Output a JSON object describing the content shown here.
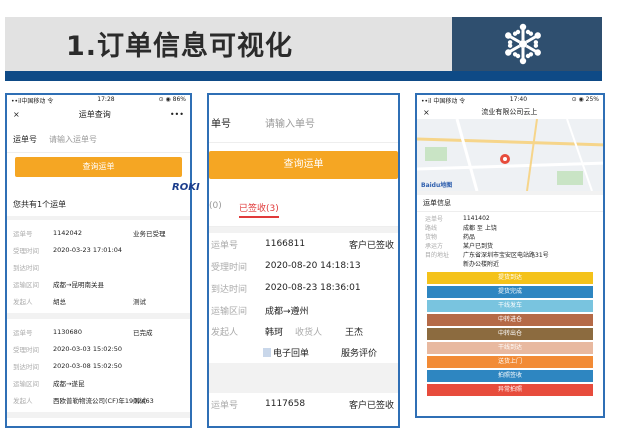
{
  "header": {
    "title": "1.订单信息可视化"
  },
  "p1": {
    "status_left": "••il中国移动 令",
    "status_time": "17:28",
    "status_right": "⊙ ◉ 86%",
    "close": "×",
    "nav_title": "运单查询",
    "more": "•••",
    "input_label": "运单号",
    "input_placeholder": "请输入运单号",
    "query_button": "查询运单",
    "count_text": "您共有1个运单",
    "watermark": "ROKI",
    "orders": [
      {
        "rows": [
          [
            "运单号",
            "1142042",
            "业务已受理"
          ],
          [
            "受理时间",
            "2020-03-23 17:01:04",
            ""
          ],
          [
            "到达时间",
            "",
            ""
          ],
          [
            "运输区间",
            "成都→昆明南关县",
            ""
          ],
          [
            "发起人",
            "胡总",
            "测试"
          ]
        ]
      },
      {
        "rows": [
          [
            "运单号",
            "1130680",
            "已完成"
          ],
          [
            "受理时间",
            "2020-03-03 15:02:50",
            ""
          ],
          [
            "到达时间",
            "2020-03-08 15:02:50",
            ""
          ],
          [
            "运输区间",
            "成都→遂昆",
            ""
          ],
          [
            "发起人",
            "西欧普勒物流公司(CF)年1902463",
            "测试"
          ]
        ]
      }
    ]
  },
  "p2": {
    "input_label": "单号",
    "input_placeholder": "请输入单号",
    "query_button": "查询运单",
    "tab_left": "(0)",
    "tab_active": "已签收(3)",
    "rows": [
      [
        "运单号",
        "1166811",
        "客户已签收"
      ],
      [
        "受理时间",
        "2020-08-20 14:18:13",
        ""
      ],
      [
        "到达时间",
        "2020-08-23 18:36:01",
        ""
      ],
      [
        "运输区间",
        "成都→遵州",
        ""
      ]
    ],
    "person_label": "发起人",
    "person_name": "韩珂",
    "receiver_label": "收货人",
    "receiver_name": "王杰",
    "receipt": "电子回单",
    "review": "服务评价",
    "next_label": "运单号",
    "next_no": "1117658",
    "next_status": "客户已签收"
  },
  "p3": {
    "status_left": "••il 中国移动 令",
    "status_time": "17:40",
    "status_right": "⊙ ◉ 25%",
    "close": "×",
    "nav_title": "流业有限公司云上",
    "map_brand": "Baidu地图",
    "info_title": "运单信息",
    "info": [
      [
        "运单号",
        "1141402"
      ],
      [
        "路线",
        "成都 至 上饶"
      ],
      [
        "货物",
        "药品"
      ],
      [
        "承运方",
        "某户已到货"
      ],
      [
        "目的地址",
        "广东省深圳市宝安区电站路31号"
      ],
      [
        "",
        "新办公楼附近"
      ]
    ],
    "bars": [
      {
        "label": "提货到达",
        "color": "#f4c21a"
      },
      {
        "label": "提货完成",
        "color": "#2e86c1"
      },
      {
        "label": "干线发车",
        "color": "#79c4df"
      },
      {
        "label": "中转进仓",
        "color": "#b56a47"
      },
      {
        "label": "中转出仓",
        "color": "#8c6b3f"
      },
      {
        "label": "干线到达",
        "color": "#e8b9a0"
      },
      {
        "label": "送货上门",
        "color": "#f28b36"
      },
      {
        "label": "拍照签收",
        "color": "#2e86c1"
      },
      {
        "label": "异常拍照",
        "color": "#e74c3c"
      }
    ]
  }
}
